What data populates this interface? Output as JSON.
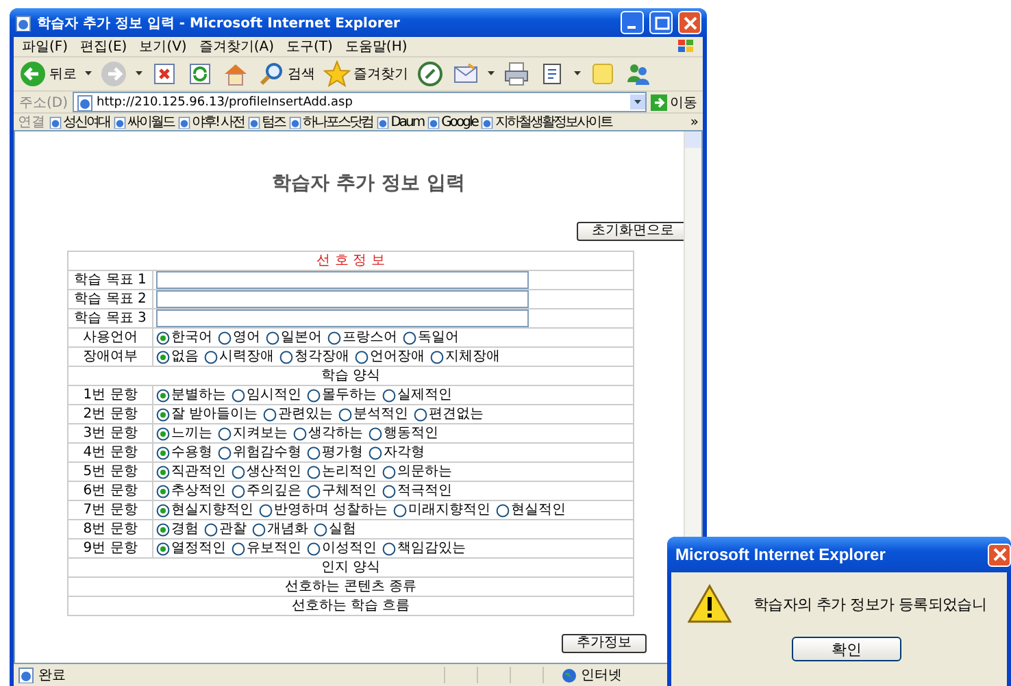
{
  "window": {
    "title": "학습자 추가 정보 입력 - Microsoft Internet Explorer"
  },
  "menu": [
    "파일(F)",
    "편집(E)",
    "보기(V)",
    "즐겨찾기(A)",
    "도구(T)",
    "도움말(H)"
  ],
  "toolbar": [
    {
      "kind": "back",
      "label": "뒤로"
    },
    {
      "kind": "forward"
    },
    {
      "kind": "stop"
    },
    {
      "kind": "refresh"
    },
    {
      "kind": "home"
    },
    {
      "kind": "search",
      "label": "검색"
    },
    {
      "kind": "favorites",
      "label": "즐겨찾기"
    },
    {
      "kind": "media"
    },
    {
      "kind": "mail"
    },
    {
      "kind": "print"
    },
    {
      "kind": "edit"
    },
    {
      "kind": "note"
    },
    {
      "kind": "messenger"
    }
  ],
  "address": {
    "label": "주소(D)",
    "url": "http://210.125.96.13/profileInsertAdd.asp",
    "go": "이동"
  },
  "links": {
    "label": "연결",
    "items": [
      "성신여대",
      "싸이월드",
      "야후! 사전",
      "텀즈",
      "하나포스닷컴",
      "Daum",
      "Google",
      "지하철생활정보사이트"
    ],
    "more": "»"
  },
  "page": {
    "title": "학습자 추가 정보 입력",
    "reset_button": "초기화면으로",
    "submit_button": "추가정보",
    "rows": [
      {
        "kind": "title",
        "label": "선 호 정 보"
      },
      {
        "kind": "text",
        "label": "학습 목표 1"
      },
      {
        "kind": "text",
        "label": "학습 목표 2"
      },
      {
        "kind": "text",
        "label": "학습 목표 3"
      },
      {
        "kind": "radio",
        "label": "사용언어",
        "options": [
          {
            "label": "한국어",
            "selected": true
          },
          {
            "label": "영어",
            "selected": false
          },
          {
            "label": "일본어",
            "selected": false
          },
          {
            "label": "프랑스어",
            "selected": false
          },
          {
            "label": "독일어",
            "selected": false
          }
        ]
      },
      {
        "kind": "radio",
        "label": "장애여부",
        "options": [
          {
            "label": "없음",
            "selected": true
          },
          {
            "label": "시력장애",
            "selected": false
          },
          {
            "label": "청각장애",
            "selected": false
          },
          {
            "label": "언어장애",
            "selected": false
          },
          {
            "label": "지체장애",
            "selected": false
          }
        ]
      },
      {
        "kind": "heading",
        "label": "학습 양식"
      },
      {
        "kind": "radio",
        "label": "1번 문항",
        "options": [
          {
            "label": "분별하는",
            "selected": true
          },
          {
            "label": "임시적인",
            "selected": false
          },
          {
            "label": "몰두하는",
            "selected": false
          },
          {
            "label": "실제적인",
            "selected": false
          }
        ]
      },
      {
        "kind": "radio",
        "label": "2번 문항",
        "options": [
          {
            "label": "잘 받아들이는",
            "selected": true
          },
          {
            "label": "관련있는",
            "selected": false
          },
          {
            "label": "분석적인",
            "selected": false
          },
          {
            "label": "편견없는",
            "selected": false
          }
        ]
      },
      {
        "kind": "radio",
        "label": "3번 문항",
        "options": [
          {
            "label": "느끼는",
            "selected": true
          },
          {
            "label": "지켜보는",
            "selected": false
          },
          {
            "label": "생각하는",
            "selected": false
          },
          {
            "label": "행동적인",
            "selected": false
          }
        ]
      },
      {
        "kind": "radio",
        "label": "4번 문항",
        "options": [
          {
            "label": "수용형",
            "selected": true
          },
          {
            "label": "위험감수형",
            "selected": false
          },
          {
            "label": "평가형",
            "selected": false
          },
          {
            "label": "자각형",
            "selected": false
          }
        ]
      },
      {
        "kind": "radio",
        "label": "5번 문항",
        "options": [
          {
            "label": "직관적인",
            "selected": true
          },
          {
            "label": "생산적인",
            "selected": false
          },
          {
            "label": "논리적인",
            "selected": false
          },
          {
            "label": "의문하는",
            "selected": false
          }
        ]
      },
      {
        "kind": "radio",
        "label": "6번 문항",
        "options": [
          {
            "label": "추상적인",
            "selected": true
          },
          {
            "label": "주의깊은",
            "selected": false
          },
          {
            "label": "구체적인",
            "selected": false
          },
          {
            "label": "적극적인",
            "selected": false
          }
        ]
      },
      {
        "kind": "radio",
        "label": "7번 문항",
        "options": [
          {
            "label": "현실지향적인",
            "selected": true
          },
          {
            "label": "반영하며 성찰하는",
            "selected": false
          },
          {
            "label": "미래지향적인",
            "selected": false
          },
          {
            "label": "현실적인",
            "selected": false
          }
        ]
      },
      {
        "kind": "radio",
        "label": "8번 문항",
        "options": [
          {
            "label": "경험",
            "selected": true
          },
          {
            "label": "관찰",
            "selected": false
          },
          {
            "label": "개념화",
            "selected": false
          },
          {
            "label": "실험",
            "selected": false
          }
        ]
      },
      {
        "kind": "radio",
        "label": "9번 문항",
        "options": [
          {
            "label": "열정적인",
            "selected": true
          },
          {
            "label": "유보적인",
            "selected": false
          },
          {
            "label": "이성적인",
            "selected": false
          },
          {
            "label": "책임감있는",
            "selected": false
          }
        ]
      },
      {
        "kind": "heading",
        "label": "인지 양식"
      },
      {
        "kind": "heading",
        "label": "선호하는 콘텐츠 종류"
      },
      {
        "kind": "heading",
        "label": "선호하는 학습 흐름"
      }
    ]
  },
  "status_bar": {
    "text": "완료",
    "zone": "인터넷"
  },
  "dialog": {
    "title": "Microsoft Internet Explorer",
    "message": "학습자의 추가 정보가 등록되었습니",
    "button": "확인"
  }
}
